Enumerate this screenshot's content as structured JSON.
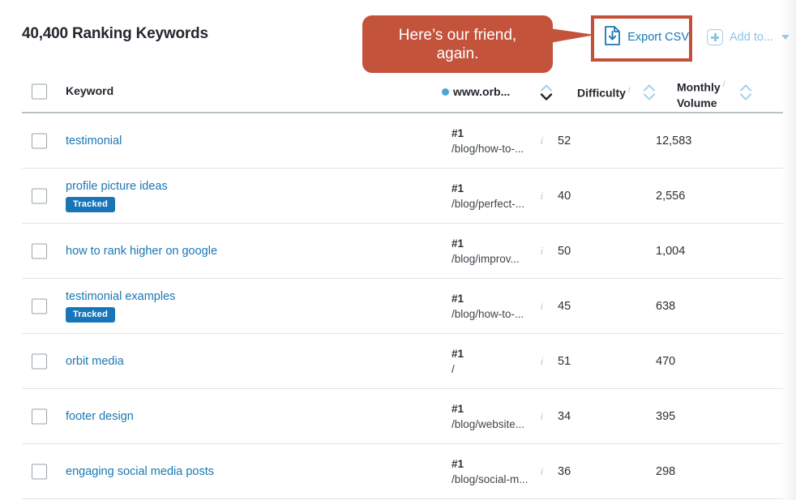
{
  "page": {
    "title": "40,400 Ranking Keywords"
  },
  "callout": {
    "line1": "Here’s our friend,",
    "line2": "again.",
    "color": "#c4533c"
  },
  "toolbar": {
    "export_label": "Export CSV",
    "export_icon": "document-download-icon",
    "add_to_label": "Add to...",
    "add_to_icon": "plus-box-icon",
    "add_to_caret": "caret-down-icon",
    "highlight_color": "#c4503a",
    "link_color": "#1a77b3",
    "disabled_color": "#8fc4e2"
  },
  "table": {
    "headers": {
      "keyword": "Keyword",
      "domain": "www.orb...",
      "difficulty": "Difficulty",
      "monthly_volume_line1": "Monthly",
      "monthly_volume_line2": "Volume",
      "info_marker": "i"
    },
    "sort": {
      "active_column": "domain",
      "direction": "desc"
    },
    "select_all_checked": false,
    "rows": [
      {
        "keyword": "testimonial",
        "tracked": false,
        "badge": "",
        "rank": "#1",
        "path": "/blog/how-to-...",
        "info": "i",
        "difficulty": "52",
        "volume": "12,583",
        "checked": false
      },
      {
        "keyword": "profile picture ideas",
        "tracked": true,
        "badge": "Tracked",
        "rank": "#1",
        "path": "/blog/perfect-...",
        "info": "i",
        "difficulty": "40",
        "volume": "2,556",
        "checked": false
      },
      {
        "keyword": "how to rank higher on google",
        "tracked": false,
        "badge": "",
        "rank": "#1",
        "path": "/blog/improv...",
        "info": "i",
        "difficulty": "50",
        "volume": "1,004",
        "checked": false
      },
      {
        "keyword": "testimonial examples",
        "tracked": true,
        "badge": "Tracked",
        "rank": "#1",
        "path": "/blog/how-to-...",
        "info": "i",
        "difficulty": "45",
        "volume": "638",
        "checked": false
      },
      {
        "keyword": "orbit media",
        "tracked": false,
        "badge": "",
        "rank": "#1",
        "path": "/",
        "info": "i",
        "difficulty": "51",
        "volume": "470",
        "checked": false
      },
      {
        "keyword": "footer design",
        "tracked": false,
        "badge": "",
        "rank": "#1",
        "path": "/blog/website...",
        "info": "i",
        "difficulty": "34",
        "volume": "395",
        "checked": false
      },
      {
        "keyword": "engaging social media posts",
        "tracked": false,
        "badge": "",
        "rank": "#1",
        "path": "/blog/social-m...",
        "info": "i",
        "difficulty": "36",
        "volume": "298",
        "checked": false
      }
    ]
  }
}
